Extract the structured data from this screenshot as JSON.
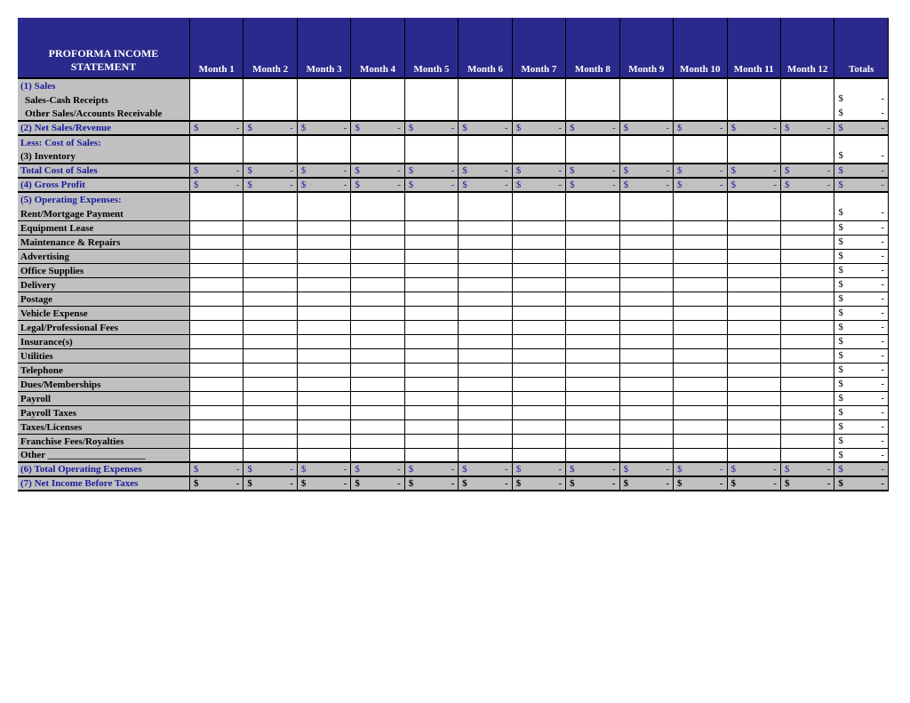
{
  "title": "PROFORMA INCOME STATEMENT",
  "months": [
    "Month 1",
    "Month 2",
    "Month 3",
    "Month 4",
    "Month 5",
    "Month 6",
    "Month 7",
    "Month 8",
    "Month 9",
    "Month 10",
    "Month 11",
    "Month 12"
  ],
  "totals_label": "Totals",
  "dollar": "$",
  "dash": "-",
  "rows": {
    "sales": "(1) Sales",
    "sales_cash": "Sales-Cash Receipts",
    "sales_ar": "Other Sales/Accounts Receivable",
    "net_sales": "(2) Net Sales/Revenue",
    "less_cos": "Less: Cost of Sales:",
    "inventory": "(3) Inventory",
    "total_cos": "Total Cost of Sales",
    "gross_profit": "(4) Gross Profit",
    "opex": "(5) Operating Expenses:",
    "rent": "Rent/Mortgage Payment",
    "equip_lease": "Equipment Lease",
    "maint": "Maintenance & Repairs",
    "advertising": "Advertising",
    "office": "Office Supplies",
    "delivery": "Delivery",
    "postage": "Postage",
    "vehicle": "Vehicle Expense",
    "legal": "Legal/Professional Fees",
    "insurance": "Insurance(s)",
    "utilities": "Utilities",
    "telephone": "Telephone",
    "dues": "Dues/Memberships",
    "payroll": "Payroll",
    "payroll_tax": "Payroll Taxes",
    "taxes_lic": "Taxes/Licenses",
    "franchise": "Franchise Fees/Royalties",
    "other": "Other ____________________",
    "total_opex": "(6) Total Operating Expenses",
    "net_income": "(7) Net Income Before Taxes"
  }
}
